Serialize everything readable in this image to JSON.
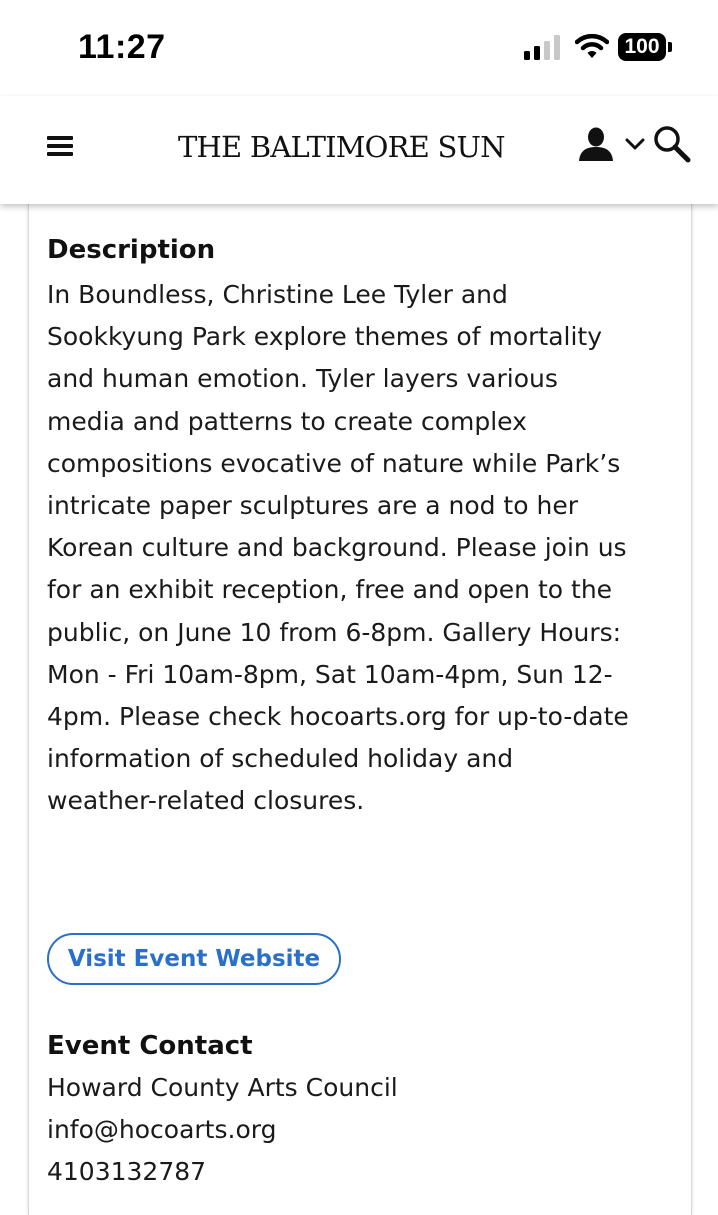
{
  "status_bar": {
    "time": "11:27",
    "battery": "100",
    "signal_bars_active": 2,
    "signal_bars_total": 4
  },
  "header": {
    "brand": "THE BALTIMORE SUN",
    "menu_icon": "hamburger-menu-icon",
    "user_icon": "user-silhouette-icon",
    "chevron_icon": "chevron-down-icon",
    "search_icon": "magnifier-search-icon"
  },
  "description": {
    "heading": "Description",
    "lines": [
      "In Boundless, Christine Lee Tyler and",
      "Sookkyung Park explore themes of mortality",
      "and human emotion. Tyler layers various",
      "media and patterns to create complex",
      "compositions evocative of nature while Park’s",
      "intricate paper sculptures are a nod to her",
      "Korean culture and background. Please join us",
      "for an exhibit reception, free and open to the",
      "public, on June 10 from 6-8pm. Gallery Hours:",
      "Mon - Fri 10am-8pm, Sat 10am-4pm, Sun 12-",
      "4pm. Please check hocoarts.org for up-to-date",
      "information of scheduled holiday and",
      "weather-related closures."
    ]
  },
  "visit_button": {
    "label": "Visit Event Website"
  },
  "event_contact": {
    "heading": "Event Contact",
    "organization": "Howard County Arts Council",
    "email": "info@hocoarts.org",
    "phone": "4103132787"
  },
  "colors": {
    "accent_blue": "#2a6fc9",
    "text": "#1a1a1a"
  }
}
